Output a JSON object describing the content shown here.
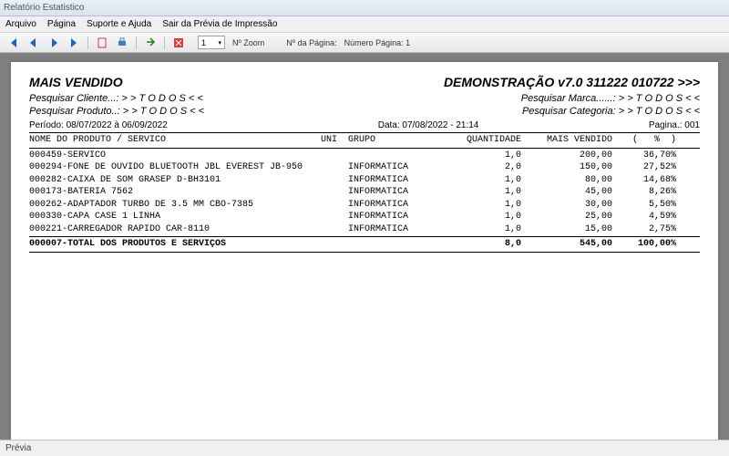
{
  "window": {
    "title": "Relatório Estatistico"
  },
  "menu": {
    "arquivo": "Arquivo",
    "pagina": "Página",
    "suporte": "Suporte e Ajuda",
    "sair": "Sair da Prévia de Impressão"
  },
  "toolbar": {
    "zoom_value": "1",
    "zoom_label": "Nº Zoom",
    "page_label": "Nº da Página:",
    "page_value": "Número Página: 1"
  },
  "report": {
    "title_left": "MAIS VENDIDO",
    "title_right": "DEMONSTRAÇÃO v7.0 311222 010722 >>>",
    "filter_client_label": "Pesquisar Cliente...:",
    "filter_client_value": "> >  T O D O S  < <",
    "filter_product_label": "Pesquisar Produto..:",
    "filter_product_value": "> >  T O D O S  < <",
    "filter_brand_label": "Pesquisar Marca......:",
    "filter_brand_value": "> >  T O D O S  < <",
    "filter_cat_label": "Pesquisar Categoria:",
    "filter_cat_value": "> >  T O D O S  < <",
    "period": "Período: 08/07/2022 à 06/09/2022",
    "datetime": "Data: 07/08/2022 - 21:14",
    "page_num": "Pagina.: 001",
    "col_prod": "NOME DO PRODUTO / SERVICO",
    "col_uni": "UNI",
    "col_grp": "GRUPO",
    "col_qtd": "QUANTIDADE",
    "col_val": "MAIS VENDIDO",
    "col_pct": "(   %  )",
    "rows": [
      {
        "prod": "000459-SERVICO",
        "uni": "",
        "grp": "",
        "qtd": "1,0",
        "val": "200,00",
        "pct": "36,70%"
      },
      {
        "prod": "000294-FONE DE OUVIDO BLUETOOTH JBL EVEREST JB-950",
        "uni": "",
        "grp": "INFORMATICA",
        "qtd": "2,0",
        "val": "150,00",
        "pct": "27,52%"
      },
      {
        "prod": "000282-CAIXA DE SOM GRASEP D-BH3101",
        "uni": "",
        "grp": "INFORMATICA",
        "qtd": "1,0",
        "val": "80,00",
        "pct": "14,68%"
      },
      {
        "prod": "000173-BATERIA 7562",
        "uni": "",
        "grp": "INFORMATICA",
        "qtd": "1,0",
        "val": "45,00",
        "pct": "8,26%"
      },
      {
        "prod": "000262-ADAPTADOR TURBO DE 3.5 MM CBO-7385",
        "uni": "",
        "grp": "INFORMATICA",
        "qtd": "1,0",
        "val": "30,00",
        "pct": "5,50%"
      },
      {
        "prod": "000330-CAPA CASE 1 LINHA",
        "uni": "",
        "grp": "INFORMATICA",
        "qtd": "1,0",
        "val": "25,00",
        "pct": "4,59%"
      },
      {
        "prod": "000221-CARREGADOR RAPIDO CAR-8110",
        "uni": "",
        "grp": "INFORMATICA",
        "qtd": "1,0",
        "val": "15,00",
        "pct": "2,75%"
      }
    ],
    "total": {
      "prod": "000007-TOTAL DOS PRODUTOS E SERVIÇOS",
      "qtd": "8,0",
      "val": "545,00",
      "pct": "100,00%"
    }
  },
  "status": {
    "label": "Prévia"
  }
}
